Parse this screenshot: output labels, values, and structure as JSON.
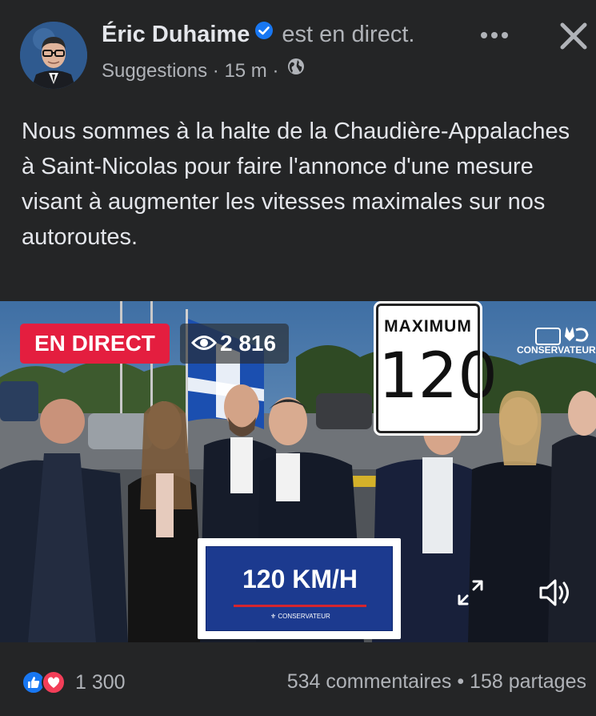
{
  "post": {
    "author": "Éric Duhaime",
    "status": "est en direct.",
    "meta": {
      "source": "Suggestions",
      "time": "15 m",
      "separator": "·"
    },
    "text": "Nous sommes à la halte de la Chaudière-Appalaches à Saint-Nicolas pour faire l'annonce d'une mesure visant à augmenter les vitesses maximales sur nos autoroutes."
  },
  "video": {
    "live_badge": "EN DIRECT",
    "viewers": "2 816",
    "speed_sign": {
      "top": "MAXIMUM",
      "value": "120"
    },
    "watermark": "CONSERVATEUR",
    "podium": {
      "title": "120 KM/H",
      "logo_text": "CONSERVATEUR"
    }
  },
  "footer": {
    "reaction_count": "1 300",
    "comments": "534 commentaires",
    "separator": "•",
    "shares": "158 partages"
  },
  "icons": {
    "verified": "verified-badge-icon",
    "globe": "globe-icon",
    "more": "more-options-icon",
    "close": "close-icon",
    "eye": "eye-icon",
    "expand": "expand-icon",
    "volume": "volume-icon",
    "like": "like-reaction-icon",
    "love": "love-reaction-icon"
  },
  "colors": {
    "background": "#242526",
    "text": "#e4e6eb",
    "secondary": "#b0b3b8",
    "live": "#e41e3f",
    "like": "#1877f2",
    "love": "#f33e58",
    "podium": "#1c3a8f"
  }
}
